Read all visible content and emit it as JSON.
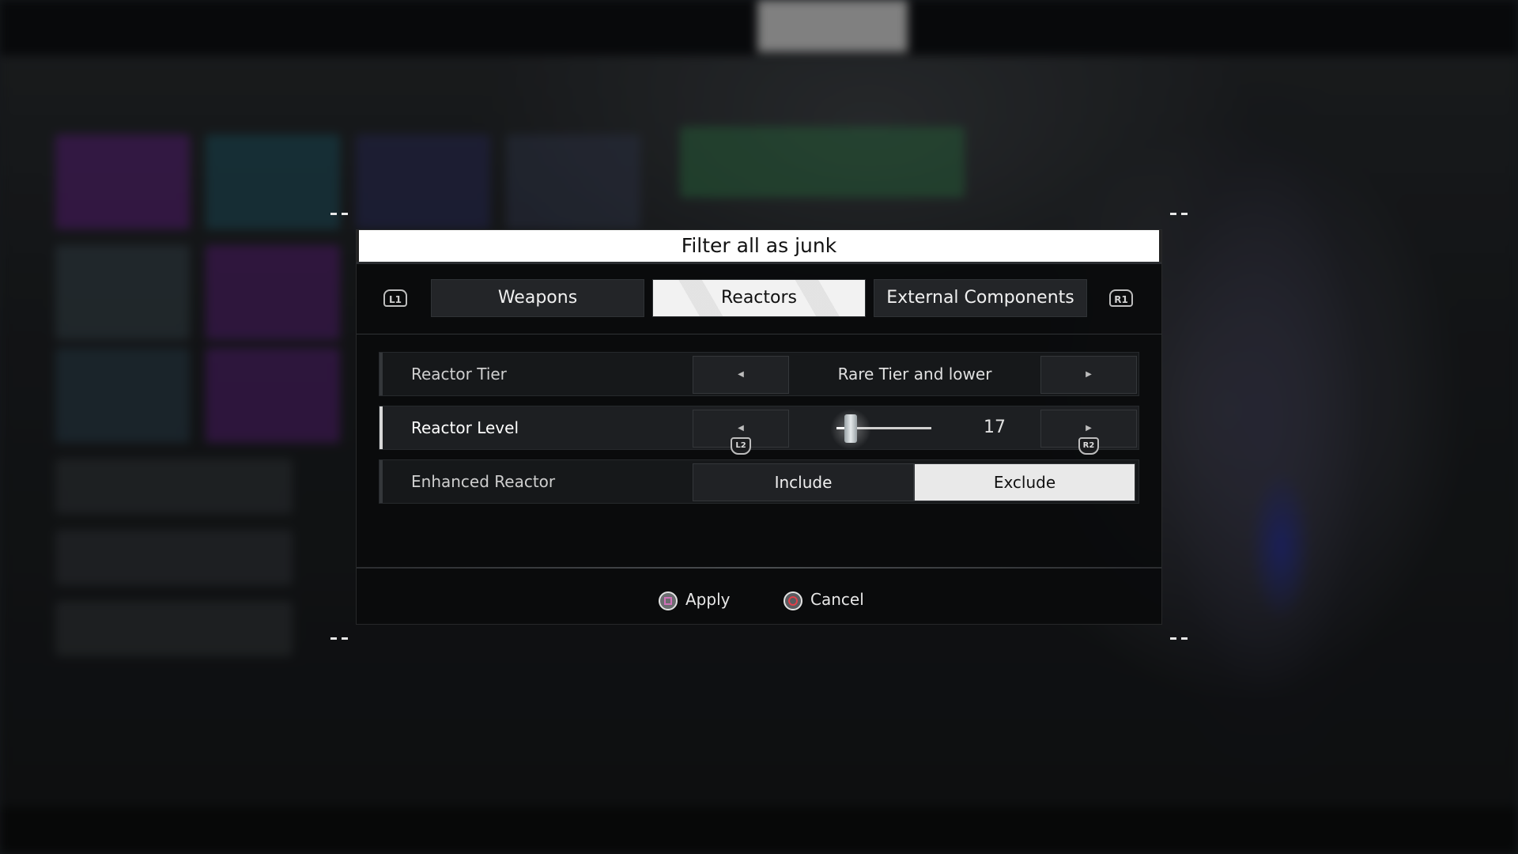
{
  "dialog": {
    "title": "Filter all as junk",
    "bumper_left": "L1",
    "bumper_right": "R1",
    "tabs": [
      {
        "label": "Weapons",
        "active": false
      },
      {
        "label": "Reactors",
        "active": true
      },
      {
        "label": "External Components",
        "active": false
      }
    ],
    "filters": {
      "tier": {
        "label": "Reactor Tier",
        "value": "Rare Tier and lower"
      },
      "level": {
        "label": "Reactor Level",
        "value": "17",
        "slider_fraction": 0.15,
        "left_trigger": "L2",
        "right_trigger": "R2"
      },
      "enhanced": {
        "label": "Enhanced Reactor",
        "options": [
          "Include",
          "Exclude"
        ],
        "selected": "Exclude"
      }
    },
    "actions": {
      "apply": "Apply",
      "cancel": "Cancel"
    }
  },
  "colors": {
    "title_bg": "#ffffff",
    "active_tab_bg": "#f2f2f2",
    "apply_icon_accent": "#d070b8",
    "cancel_icon_accent": "#e2404a"
  },
  "icons": {
    "apply": "square-button-icon",
    "cancel": "circle-button-icon",
    "left_arrow": "left-arrow-icon",
    "right_arrow": "right-arrow-icon"
  }
}
